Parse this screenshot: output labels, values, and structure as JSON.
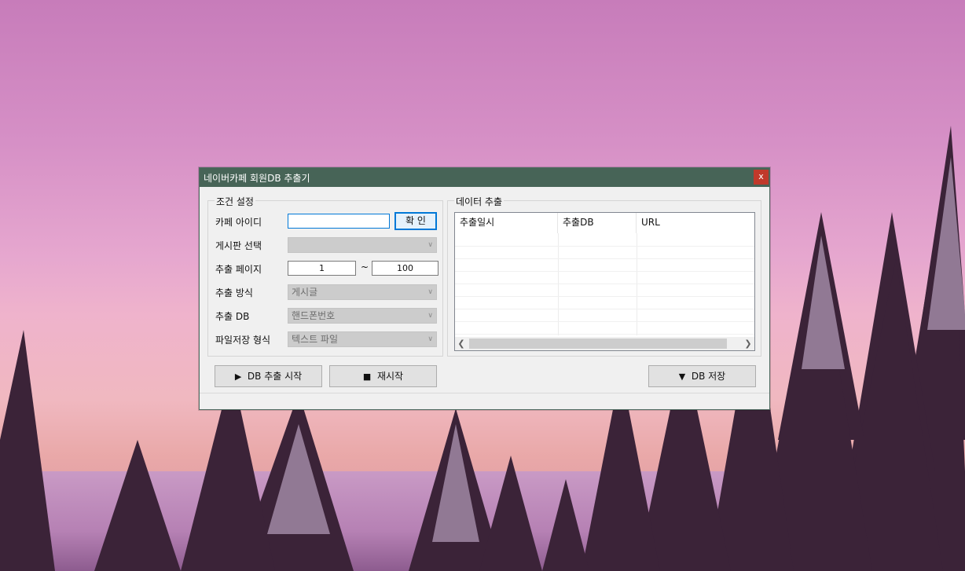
{
  "window": {
    "title": "네이버카페 회원DB 추출기",
    "close_label": "x"
  },
  "conditions": {
    "legend": "조건 설정",
    "cafe_id_label": "카페 아이디",
    "cafe_id_value": "",
    "confirm_label": "확 인",
    "board_label": "게시판 선택",
    "board_value": "",
    "page_label": "추출 페이지",
    "page_from": "1",
    "page_sep": "~",
    "page_to": "100",
    "method_label": "추출 방식",
    "method_value": "게시글",
    "db_label": "추출 DB",
    "db_value": "핸드폰번호",
    "format_label": "파일저장 형식",
    "format_value": "텍스트 파일"
  },
  "extraction": {
    "legend": "데이터 추출",
    "columns": [
      "추출일시",
      "추출DB",
      "URL"
    ],
    "rows": []
  },
  "buttons": {
    "start_label": "DB 추출 시작",
    "restart_label": "재시작",
    "save_label": "DB 저장"
  }
}
